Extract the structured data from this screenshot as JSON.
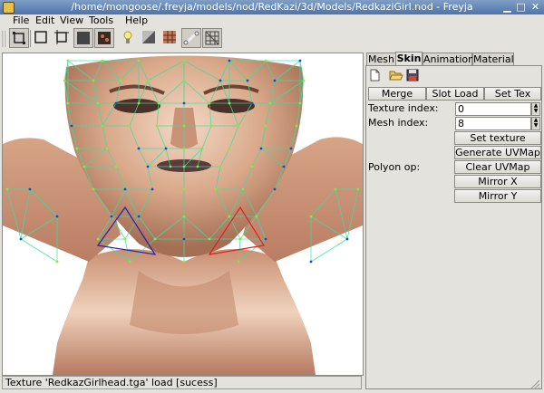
{
  "window": {
    "title": "/home/mongoose/.freyja/models/nod/RedKazi/3d/Models/RedkaziGirl.nod - Freyja",
    "buttons": {
      "minimize": "▁",
      "maximize": "□",
      "close": "✕"
    }
  },
  "menu": {
    "items": [
      {
        "label": "File"
      },
      {
        "label": "Edit"
      },
      {
        "label": "View"
      },
      {
        "label": "Tools"
      },
      {
        "label": "Help"
      }
    ]
  },
  "toolbar": {
    "tools": [
      {
        "icon": "new-frame-icon",
        "pressed": true
      },
      {
        "icon": "frame-icon",
        "pressed": false
      },
      {
        "icon": "crop-frame-icon",
        "pressed": false
      },
      {
        "icon": "solid-shade-icon",
        "pressed": true
      },
      {
        "icon": "texture-shade-icon",
        "pressed": true
      },
      {
        "icon": "light-bulb-icon",
        "pressed": false
      },
      {
        "icon": "material-icon",
        "pressed": false
      },
      {
        "icon": "texture-grid-icon",
        "pressed": false
      },
      {
        "icon": "bone-icon",
        "pressed": true
      },
      {
        "icon": "wireframe-grid-icon",
        "pressed": true
      }
    ]
  },
  "tabs": [
    {
      "label": "Mesh",
      "active": false
    },
    {
      "label": "Skin",
      "active": true
    },
    {
      "label": "Animation",
      "active": false
    },
    {
      "label": "Material",
      "active": false
    }
  ],
  "skin": {
    "file_icons": [
      "new-file-icon",
      "open-folder-icon",
      "save-disk-icon"
    ],
    "merge": "Merge",
    "slot_load": "Slot Load",
    "set_tex": "Set Tex",
    "texture_index_label": "Texture index:",
    "texture_index_value": "0",
    "mesh_index_label": "Mesh index:",
    "mesh_index_value": "8",
    "set_texture": "Set texture",
    "generate_uvmap": "Generate UVMap",
    "polyon_op_label": "Polyon op:",
    "clear_uvmap": "Clear UVMap",
    "mirror_x": "Mirror X",
    "mirror_y": "Mirror Y"
  },
  "status": {
    "message": "Texture 'RedkazGirlhead.tga' load [sucess]"
  },
  "colors": {
    "titlebar": "#5a7cb0",
    "wireframe": "#38e0a0",
    "vertex": "#2244cc",
    "selected_left": "#2222aa",
    "selected_right": "#dd2222"
  }
}
